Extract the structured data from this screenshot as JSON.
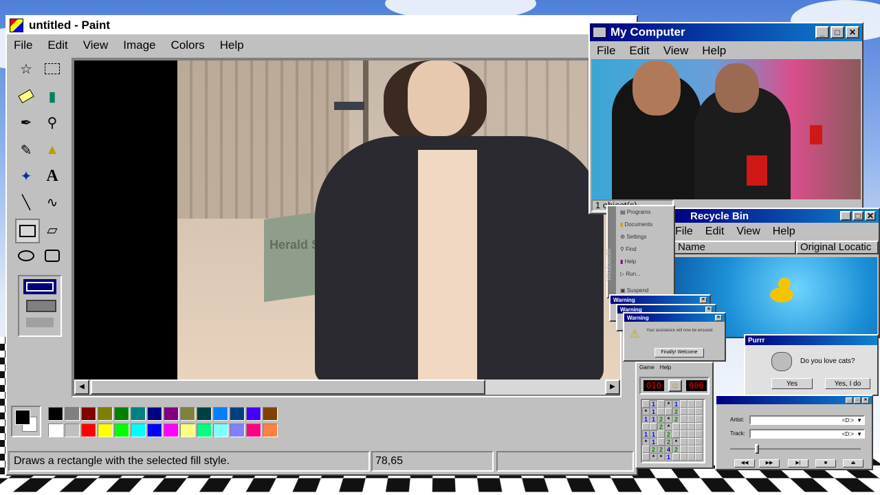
{
  "paint": {
    "title": "untitled - Paint",
    "menu": [
      "File",
      "Edit",
      "View",
      "Image",
      "Colors",
      "Help"
    ],
    "status_text": "Draws a rectangle with the selected fill style.",
    "coords": "78,65",
    "palette_top": [
      "#000000",
      "#808080",
      "#800000",
      "#808000",
      "#008000",
      "#008080",
      "#000080",
      "#800080",
      "#808040",
      "#004040",
      "#0080ff",
      "#004080",
      "#4000ff",
      "#804000"
    ],
    "palette_bottom": [
      "#ffffff",
      "#c0c0c0",
      "#ff0000",
      "#ffff00",
      "#00ff00",
      "#00ffff",
      "#0000ff",
      "#ff00ff",
      "#ffff80",
      "#00ff80",
      "#80ffff",
      "#8080ff",
      "#ff0080",
      "#ff8040"
    ],
    "sign_text": "Herald Sq"
  },
  "my_computer": {
    "title": "My Computer",
    "menu": [
      "File",
      "Edit",
      "View",
      "Help"
    ],
    "status": "1 object(s)"
  },
  "recycle_bin": {
    "title": "Recycle Bin",
    "menu": [
      "File",
      "Edit",
      "View",
      "Help"
    ],
    "col_name": "Name",
    "col_location": "Original Locatic"
  },
  "start_menu": {
    "side_label": "Windows95",
    "items": [
      "Programs",
      "Documents",
      "Settings",
      "Find",
      "Help",
      "Run...",
      "Suspend"
    ]
  },
  "warnings": {
    "title": "Warning",
    "message": "Your assistance will now be ensured",
    "button": "Finally! Welcome"
  },
  "purrr": {
    "title": "Purrr",
    "question": "Do you love cats?",
    "yes": "Yes",
    "yes_i_do": "Yes, I do"
  },
  "minesweeper": {
    "menu": [
      "Game",
      "Help"
    ],
    "mines_left": "010",
    "timer": "006",
    "grid": [
      [
        "",
        "1",
        "",
        "*",
        "1",
        "",
        "",
        ""
      ],
      [
        "*",
        "1",
        "",
        "",
        "2",
        "",
        "",
        ""
      ],
      [
        "1",
        "1",
        "2",
        "*",
        "2",
        "",
        "",
        ""
      ],
      [
        "",
        "",
        "2",
        "*",
        "",
        "",
        "",
        ""
      ],
      [
        "1",
        "1",
        "",
        "2",
        "",
        "",
        "",
        ""
      ],
      [
        "*",
        "1",
        "",
        "2",
        "*",
        "",
        "",
        ""
      ],
      [
        "",
        "2",
        "2",
        "4",
        "2",
        "",
        "",
        ""
      ],
      [
        "",
        "*",
        "*",
        "1",
        "",
        "",
        "",
        ""
      ]
    ]
  },
  "cd_player": {
    "artist_label": "Artist:",
    "track_label": "Track:",
    "artist_value": "<D:>",
    "track_value": "<D:>"
  }
}
